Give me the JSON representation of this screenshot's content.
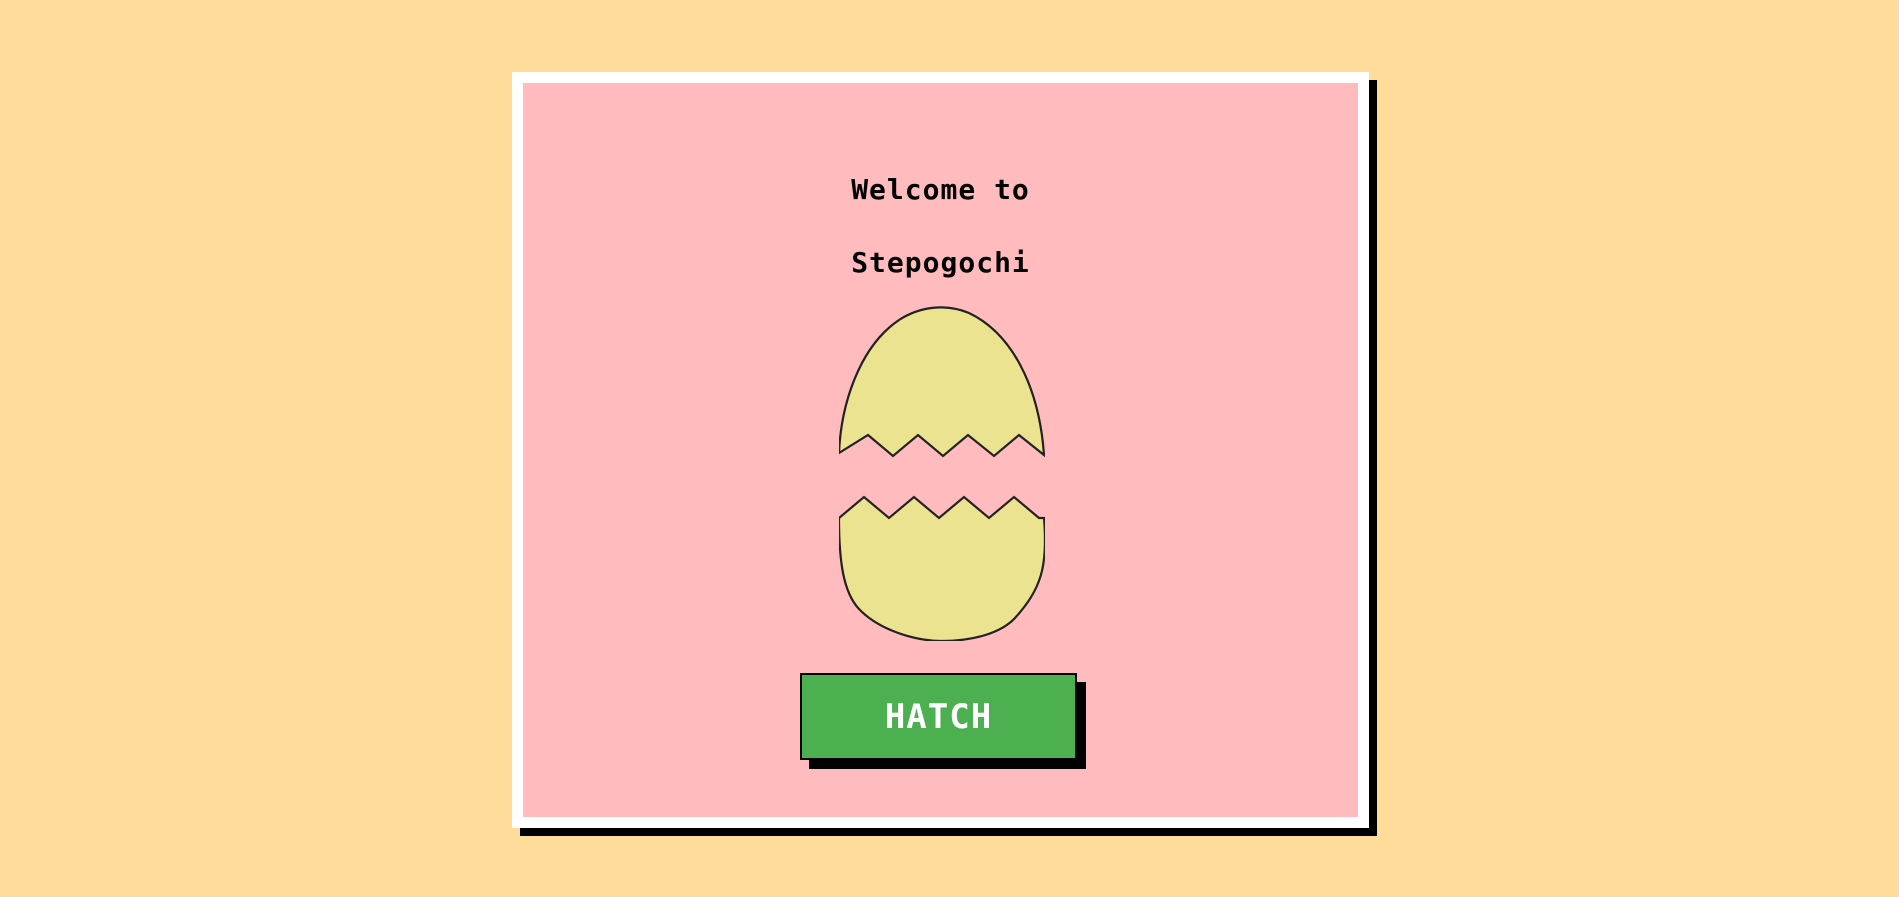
{
  "welcome": {
    "line1": "Welcome to",
    "line2": "Stepogochi"
  },
  "egg": {
    "icon": "cracked-egg-icon",
    "shell_color": "#EBE38F",
    "outline_color": "#222222"
  },
  "hatch_button": {
    "label": "HATCH",
    "color": "#4CAF50"
  },
  "colors": {
    "background": "#FFDC99",
    "card": "#FFBBBE",
    "card_border": "#FFFFFF",
    "shadow": "#000000"
  }
}
